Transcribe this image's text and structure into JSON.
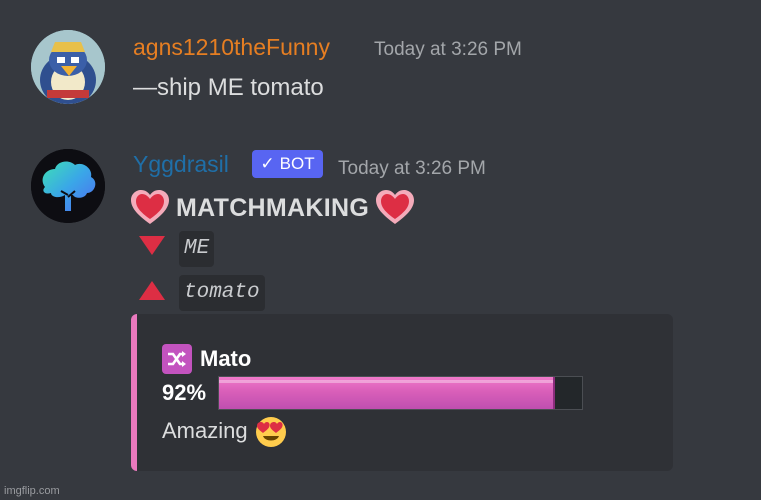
{
  "messages": [
    {
      "author": "agns1210theFunny",
      "author_color": "#e67e22",
      "timestamp": "Today at 3:26 PM",
      "content": "—ship ME tomato"
    },
    {
      "author": "Yggdrasil",
      "author_color": "#1f6fa8",
      "badge": "BOT",
      "badge_check": "✓",
      "timestamp": "Today at 3:26 PM",
      "heading": "MATCHMAKING",
      "name_down": "ME",
      "name_up": "tomato",
      "embed": {
        "accent": "#ea79be",
        "title": "Mato",
        "percent_text": "92%",
        "score": 0.92,
        "verdict": "Amazing"
      }
    }
  ],
  "icons": {
    "heart": "heart-icon",
    "triangle_down": "red-triangle-down-icon",
    "triangle_up": "red-triangle-up-icon",
    "shuffle": "shuffle-icon",
    "emoji": "heart-eyes-emoji-icon"
  },
  "watermark": "imgflip.com"
}
